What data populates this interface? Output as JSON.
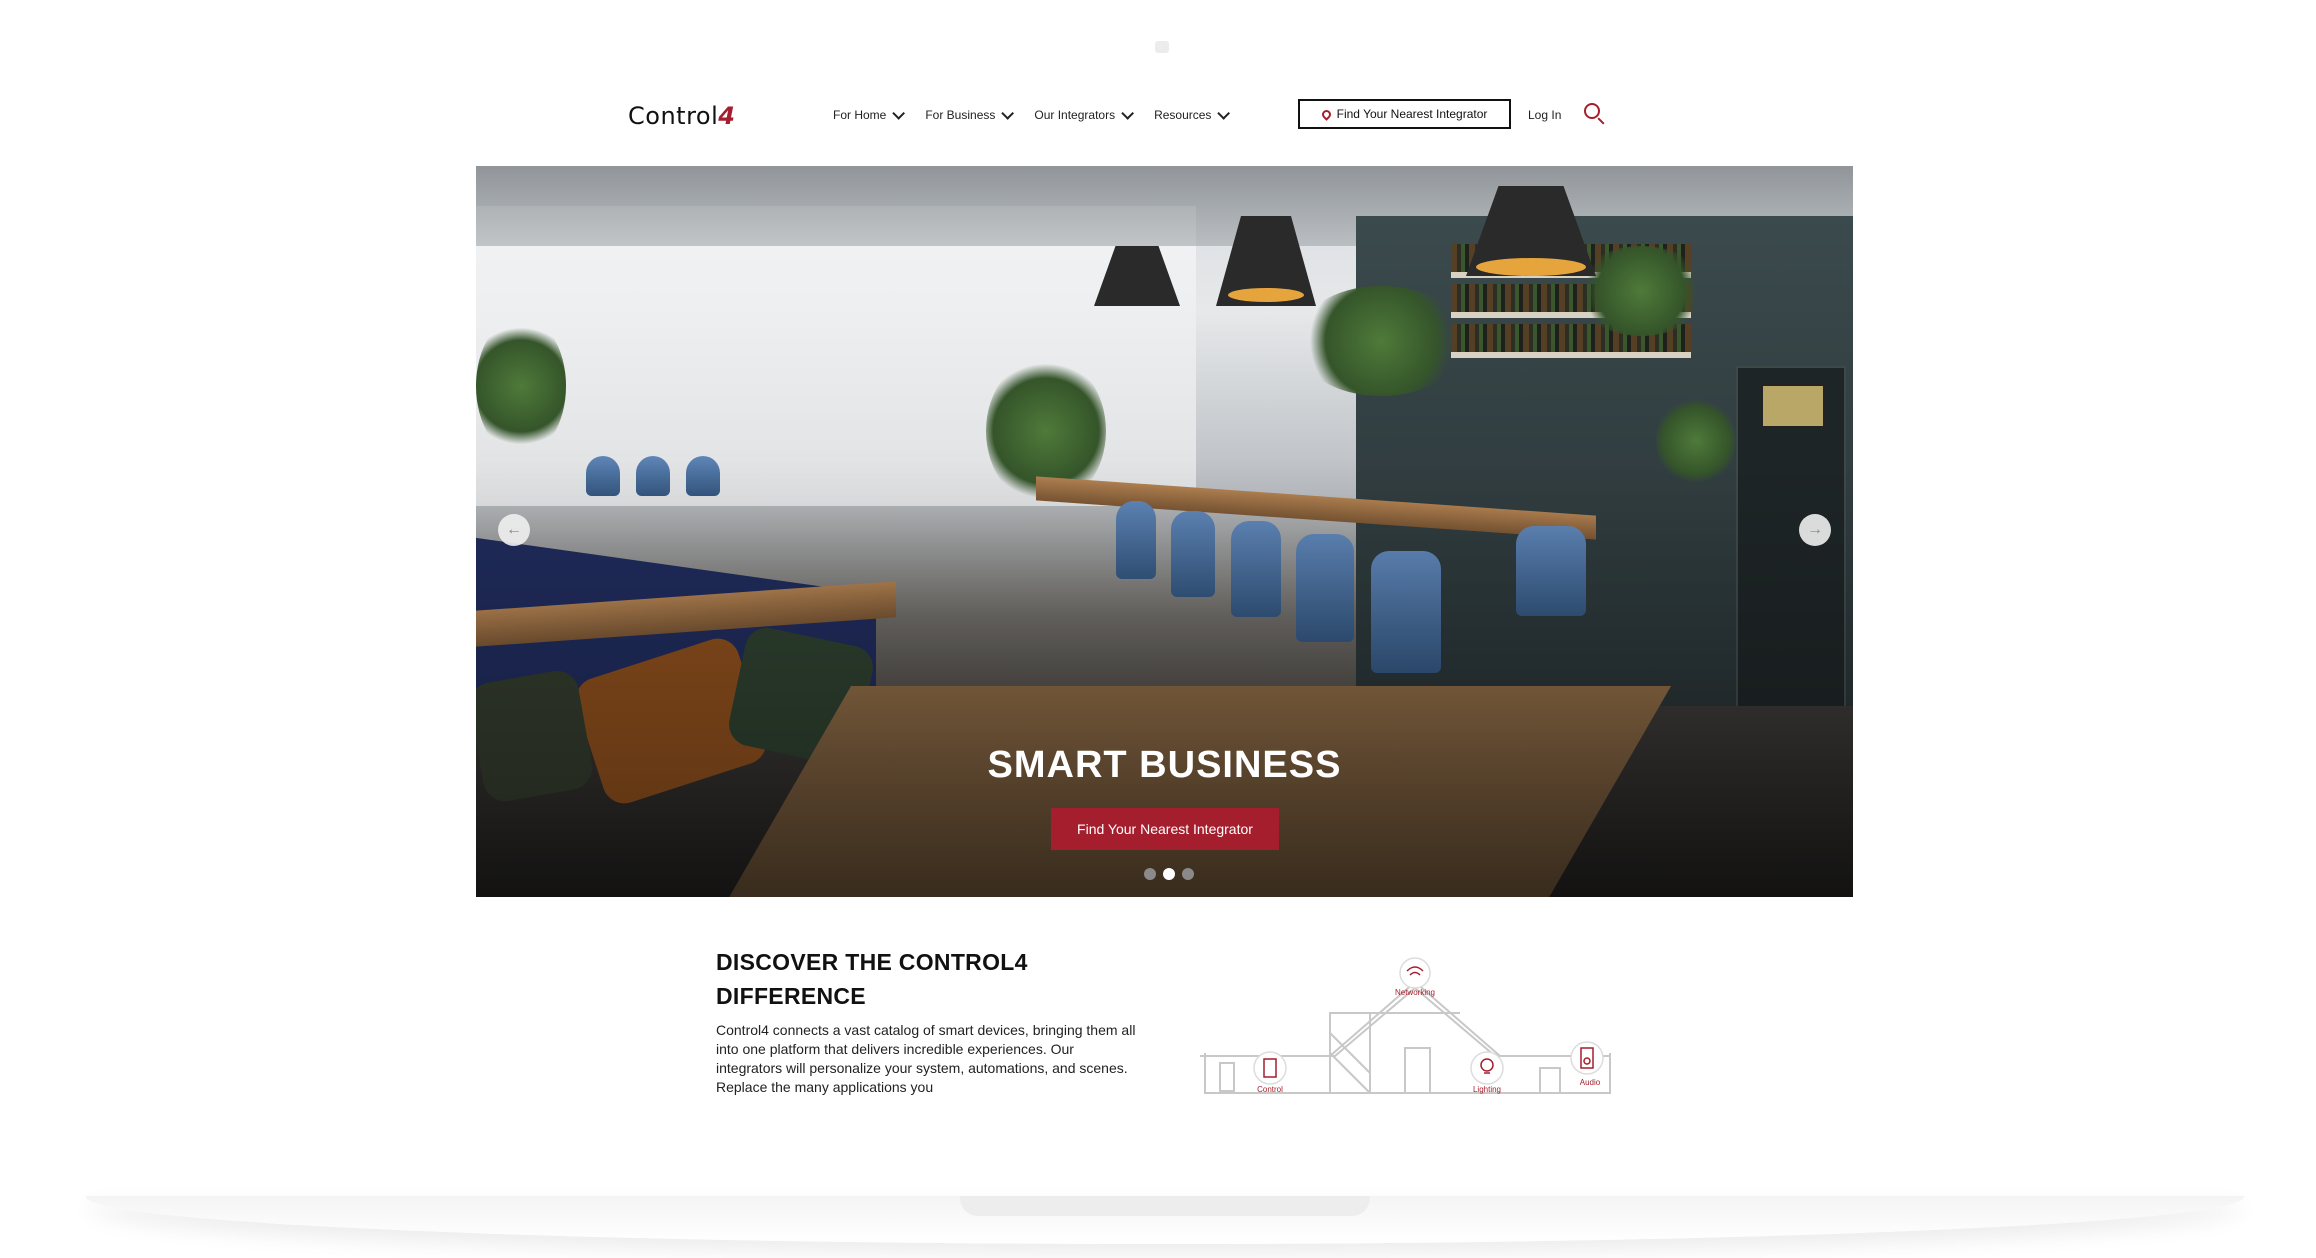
{
  "header": {
    "logo_text": "Control",
    "logo_mark": "4",
    "nav": [
      {
        "label": "For Home"
      },
      {
        "label": "For Business"
      },
      {
        "label": "Our Integrators"
      },
      {
        "label": "Resources"
      }
    ],
    "find_integrator_label": "Find Your Nearest Integrator",
    "login_label": "Log In"
  },
  "hero": {
    "title": "SMART BUSINESS",
    "cta_label": "Find Your Nearest Integrator",
    "prev_icon": "arrow-left-icon",
    "next_icon": "arrow-right-icon",
    "slides": 3,
    "active_slide": 2
  },
  "discover": {
    "title": "DISCOVER THE CONTROL4 DIFFERENCE",
    "body": "Control4 connects a vast catalog of smart devices, bringing them all into one platform that delivers incredible experiences. Our integrators will personalize your system, automations, and scenes. Replace the many applications you",
    "labels": {
      "networking": "Networking",
      "control": "Control",
      "lighting": "Lighting",
      "audio": "Audio"
    }
  },
  "colors": {
    "brand_red": "#a41e2d",
    "text": "#111111"
  }
}
